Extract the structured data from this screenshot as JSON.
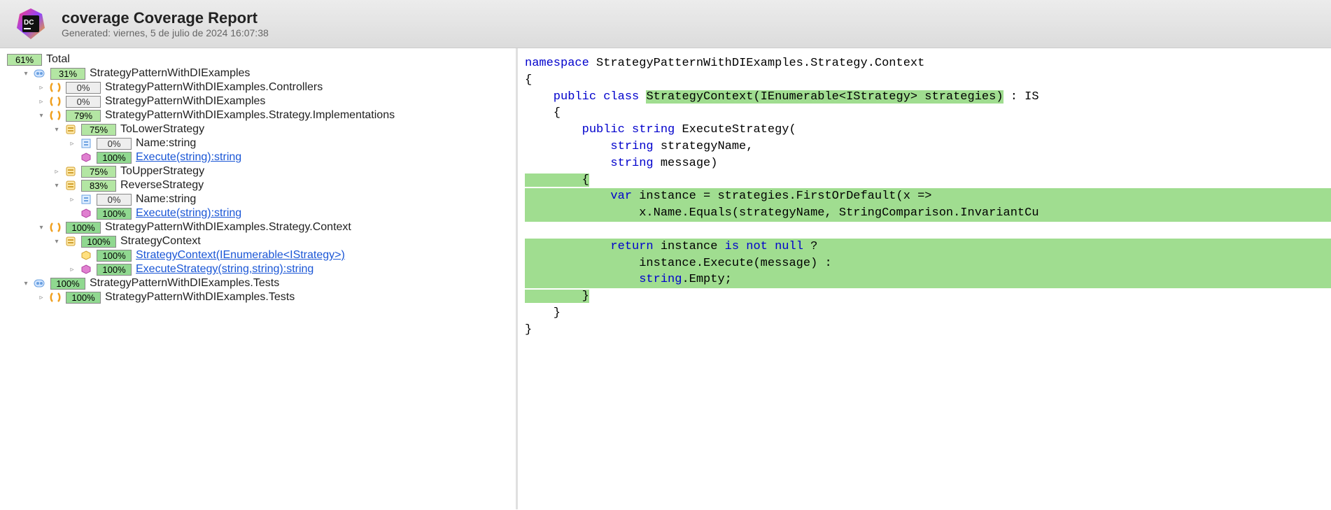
{
  "header": {
    "title": "coverage Coverage Report",
    "subtitle": "Generated: viernes, 5 de julio de 2024 16:07:38"
  },
  "tree": {
    "total_label": "Total",
    "total_pct": "61%",
    "n1": {
      "pct": "31%",
      "label": "StrategyPatternWithDIExamples"
    },
    "n2": {
      "pct": "0%",
      "label": "StrategyPatternWithDIExamples.Controllers"
    },
    "n3": {
      "pct": "0%",
      "label": "StrategyPatternWithDIExamples"
    },
    "n4": {
      "pct": "79%",
      "label": "StrategyPatternWithDIExamples.Strategy.Implementations"
    },
    "n5": {
      "pct": "75%",
      "label": "ToLowerStrategy"
    },
    "n6": {
      "pct": "0%",
      "label": "Name:string"
    },
    "n7": {
      "pct": "100%",
      "label": "Execute(string):string"
    },
    "n8": {
      "pct": "75%",
      "label": "ToUpperStrategy"
    },
    "n9": {
      "pct": "83%",
      "label": "ReverseStrategy"
    },
    "n10": {
      "pct": "0%",
      "label": "Name:string"
    },
    "n11": {
      "pct": "100%",
      "label": "Execute(string):string"
    },
    "n12": {
      "pct": "100%",
      "label": "StrategyPatternWithDIExamples.Strategy.Context"
    },
    "n13": {
      "pct": "100%",
      "label": "StrategyContext"
    },
    "n14": {
      "pct": "100%",
      "label": "StrategyContext(IEnumerable<IStrategy>)"
    },
    "n15": {
      "pct": "100%",
      "label": "ExecuteStrategy(string,string):string"
    },
    "n16": {
      "pct": "100%",
      "label": "StrategyPatternWithDIExamples.Tests"
    },
    "n17": {
      "pct": "100%",
      "label": "StrategyPatternWithDIExamples.Tests"
    }
  },
  "code": {
    "l0a": "namespace",
    "l0b": " StrategyPatternWithDIExamples.Strategy.Context",
    "l1": "{",
    "l2a": "    public class ",
    "l2b": "StrategyContext(IEnumerable<IStrategy> strategies)",
    "l2c": " : IS",
    "l3": "    {",
    "l4a": "        public string",
    "l4b": " ExecuteStrategy(",
    "l5a": "            string",
    "l5b": " strategyName,",
    "l6a": "            string",
    "l6b": " message)",
    "l7": "        {",
    "l8a": "            var",
    "l8b": " instance = strategies.FirstOrDefault(x =>",
    "l9": "                x.Name.Equals(strategyName, StringComparison.InvariantCu",
    "l11a": "            return",
    "l11b": " instance ",
    "l11c": "is not null",
    "l11d": " ?",
    "l12": "                instance.Execute(message) :",
    "l13a": "                string",
    "l13b": ".Empty;",
    "l14": "        }",
    "l15": "    }",
    "l16": "}"
  }
}
